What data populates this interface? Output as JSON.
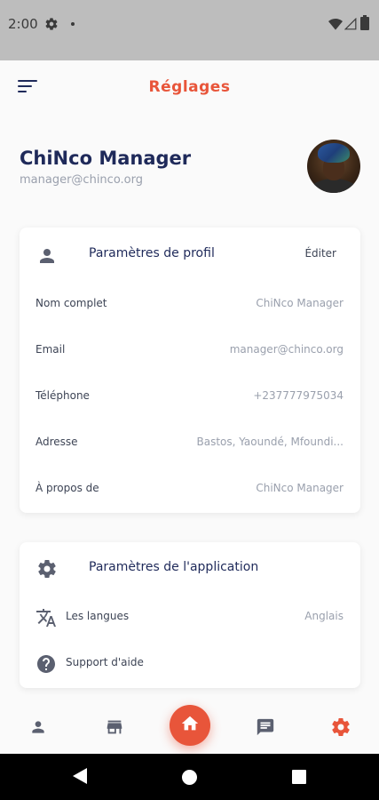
{
  "status_bar": {
    "time": "2:00"
  },
  "header": {
    "title": "Réglages",
    "menu_icon": "sort-menu-icon"
  },
  "profile": {
    "name": "ChiNco Manager",
    "email": "manager@chinco.org"
  },
  "profile_card": {
    "title": "Paramètres de profil",
    "edit_label": "Éditer",
    "rows": [
      {
        "label": "Nom complet",
        "value": "ChiNco Manager"
      },
      {
        "label": "Email",
        "value": "manager@chinco.org"
      },
      {
        "label": "Téléphone",
        "value": "+237777975034"
      },
      {
        "label": "Adresse",
        "value": "Bastos, Yaoundé, Mfoundi..."
      },
      {
        "label": "À propos de",
        "value": "ChiNco Manager"
      }
    ]
  },
  "app_card": {
    "title": "Paramètres de l'application",
    "rows": [
      {
        "icon": "translate-icon",
        "label": "Les langues",
        "value": "Anglais"
      },
      {
        "icon": "help-icon",
        "label": "Support d'aide",
        "value": ""
      }
    ]
  },
  "bottom_nav": {
    "items": [
      "person-icon",
      "store-icon",
      "home-icon",
      "chat-icon",
      "settings-icon"
    ],
    "active": "settings-icon"
  },
  "colors": {
    "accent": "#e8553a",
    "navy": "#1f2a5a",
    "muted": "#9aa0ad",
    "text": "#3d4455"
  }
}
